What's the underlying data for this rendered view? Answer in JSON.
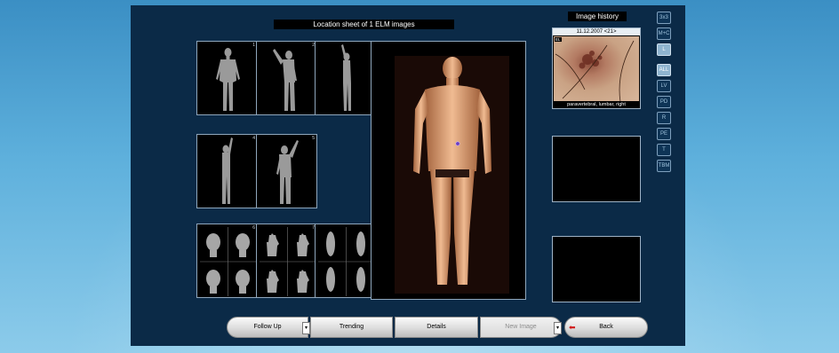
{
  "main": {
    "title": "Location sheet of 1 ELM images"
  },
  "thumbnails": [
    {
      "id": "front-body",
      "num": "1"
    },
    {
      "id": "side-body-arm-up",
      "num": "2"
    },
    {
      "id": "side-body-arms-raised",
      "num": "3"
    },
    {
      "id": "left-side-arm-up",
      "num": "4"
    },
    {
      "id": "front-body-arm-up",
      "num": "5"
    },
    {
      "id": "heads",
      "num": "6"
    },
    {
      "id": "hands",
      "num": "7"
    },
    {
      "id": "feet",
      "num": "8"
    }
  ],
  "history": {
    "title": "Image history",
    "date": "11.12.2007 <21>",
    "badge": "EL",
    "caption": "paravertebral, lumbar, right"
  },
  "side_buttons": [
    {
      "label": "3x3",
      "active": false
    },
    {
      "label": "M+C",
      "active": false
    },
    {
      "label": "L",
      "active": true
    },
    {
      "label": "ALL",
      "active": true
    },
    {
      "label": "LV",
      "active": false
    },
    {
      "label": "PD",
      "active": false
    },
    {
      "label": "R",
      "active": false
    },
    {
      "label": "PE",
      "active": false
    },
    {
      "label": "T",
      "active": false
    },
    {
      "label": "TBM",
      "active": false
    }
  ],
  "toolbar": {
    "follow_up": "Follow Up",
    "trending": "Trending",
    "details": "Details",
    "new_image": "New Image",
    "back": "Back",
    "dropdown_glyph": "▾",
    "back_arrow": "⬅"
  },
  "colors": {
    "panel": "#0b2a47",
    "accent_active": "#8fb4cf",
    "back_arrow": "#d11a1a"
  }
}
